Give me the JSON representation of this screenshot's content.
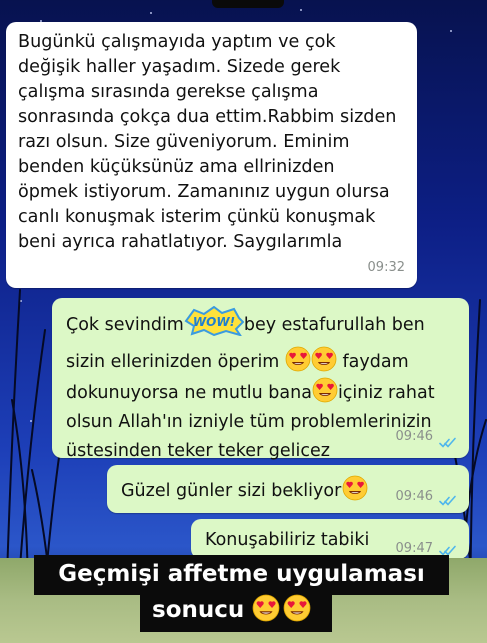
{
  "messages": [
    {
      "direction": "incoming",
      "text": "Bugünkü çalışmayıda yaptım ve çok değişik haller yaşadım. Sizede gerek çalışma sırasında gerekse çalışma sonrasında çokça dua ettim.Rabbim sizden razı olsun. Size güveniyorum. Eminim benden küçüksünüz ama ellrinizden öpmek istiyorum. Zamanınız uygun olursa canlı konuşmak isterim çünkü konuşmak beni ayrıca rahatlatıyor. Saygılarımla",
      "time": "09:32"
    },
    {
      "direction": "outgoing",
      "text_part1": "Çok sevindim",
      "sticker": "WOW!",
      "text_part2": "bey estafurullah ben sizin ellerinizden öperim",
      "text_part3": "faydam dokunuyorsa ne mutlu bana",
      "text_part4": "içiniz rahat olsun Allah'ın izniyle tüm problemlerinizin üstesinden teker teker gelicez",
      "time": "09:46",
      "status": "read"
    },
    {
      "direction": "outgoing",
      "text": "Güzel günler sizi bekliyor",
      "time": "09:46",
      "status": "read"
    },
    {
      "direction": "outgoing",
      "text": "Konuşabiliriz tabiki",
      "time": "09:47",
      "status": "read"
    }
  ],
  "caption": {
    "line1": "Geçmişi affetme uygulaması",
    "line2": "sonucu"
  },
  "icons": {
    "heart_eyes": "heart-eyes-emoji",
    "read_receipt": "double-check-icon"
  },
  "colors": {
    "incoming_bubble": "#ffffff",
    "outgoing_bubble": "#dcf8c6",
    "read_check": "#4fb6ec",
    "caption_bg": "#0b0b0b"
  }
}
